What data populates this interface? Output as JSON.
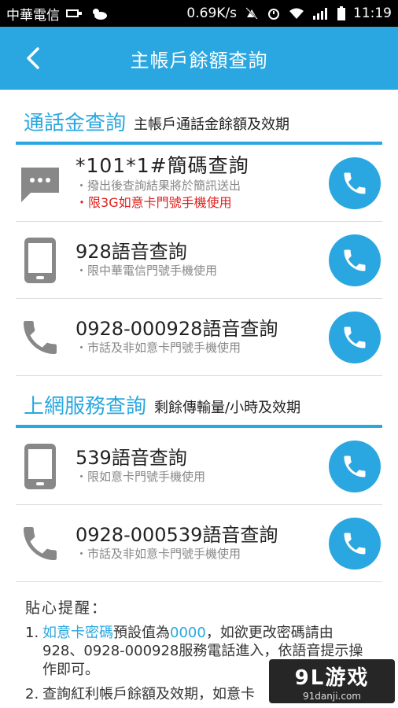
{
  "status_bar": {
    "carrier": "中華電信",
    "speed": "0.69K/s",
    "time": "11:19"
  },
  "header": {
    "title": "主帳戶餘額查詢"
  },
  "sections": [
    {
      "title": "通話金查詢",
      "subtitle": "主帳戶通話金餘額及效期",
      "items": [
        {
          "title": "*101*1#簡碼查詢",
          "notes": [
            "撥出後查詢結果將於簡訊送出"
          ],
          "red_note": "限3G如意卡門號手機使用",
          "icon": "message-icon"
        },
        {
          "title": "928語音查詢",
          "notes": [
            "限中華電信門號手機使用"
          ],
          "icon": "mobile-phone-icon"
        },
        {
          "title": "0928-000928語音查詢",
          "notes": [
            "市話及非如意卡門號手機使用"
          ],
          "icon": "landline-phone-icon"
        }
      ]
    },
    {
      "title": "上網服務查詢",
      "subtitle": "剩餘傳輸量/小時及效期",
      "items": [
        {
          "title": "539語音查詢",
          "notes": [
            "限如意卡門號手機使用"
          ],
          "icon": "mobile-phone-icon"
        },
        {
          "title": "0928-000539語音查詢",
          "notes": [
            "市話及非如意卡門號手機使用"
          ],
          "icon": "landline-phone-icon"
        }
      ]
    }
  ],
  "tips": {
    "title": "貼心提醒：",
    "tip1": {
      "num": "1.",
      "link": "如意卡密碼",
      "text_a": "預設值為",
      "code": "0000",
      "text_b": "，如欲更改密碼請由928、0928-000928服務電話進入，依語音提示操作即可。"
    },
    "tip2": {
      "num": "2.",
      "text": "查詢紅利帳戶餘額及效期，如意卡"
    }
  },
  "watermark": {
    "logo": "9L游戏",
    "url": "91danji.com"
  },
  "colors": {
    "accent": "#2aa7e0",
    "warning": "#e02020"
  }
}
